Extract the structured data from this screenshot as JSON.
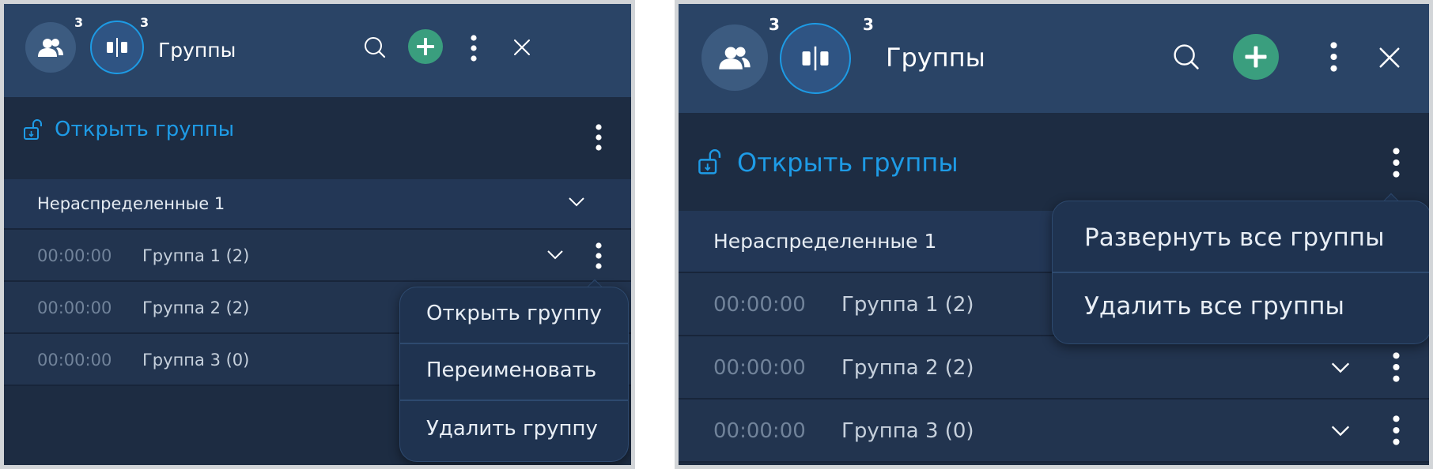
{
  "header": {
    "users_badge": "3",
    "groups_badge": "3",
    "title": "Группы",
    "icons": {
      "users": "users-icon",
      "groups": "groups-split-icon",
      "search": "search-icon",
      "add": "plus-icon",
      "more": "more-vertical-icon",
      "close": "close-icon"
    }
  },
  "open_groups_label": "Открыть группы",
  "unassigned_label": "Нераспределенные 1",
  "groups": [
    {
      "time": "00:00:00",
      "name": "Группа 1 (2)"
    },
    {
      "time": "00:00:00",
      "name": "Группа 2 (2)"
    },
    {
      "time": "00:00:00",
      "name": "Группа 3 (0)"
    }
  ],
  "group_menu": {
    "open_group": "Открыть группу",
    "rename": "Переименовать",
    "delete_group": "Удалить группу"
  },
  "all_groups_menu": {
    "expand_all": "Развернуть все группы",
    "delete_all": "Удалить все группы"
  },
  "colors": {
    "header_bg": "#2a4466",
    "panel_bg": "#1d2c42",
    "accent_blue": "#1e9be6",
    "add_green": "#3a9e7e"
  }
}
